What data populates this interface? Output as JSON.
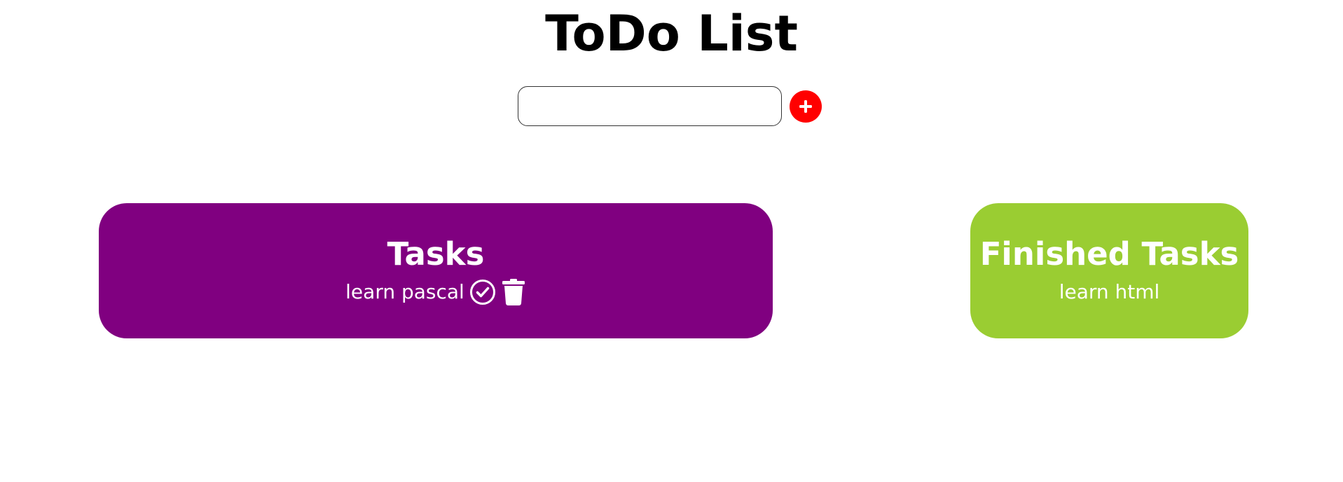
{
  "header": {
    "title": "ToDo List"
  },
  "new_task": {
    "value": "",
    "placeholder": ""
  },
  "colors": {
    "add_button": "#ff0000",
    "tasks_card": "#800080",
    "finished_card": "#9acd32"
  },
  "tasks": {
    "title": "Tasks",
    "items": [
      {
        "label": "learn pascal",
        "icons": [
          "check-circle-icon",
          "trash-icon"
        ]
      }
    ]
  },
  "finished": {
    "title": "Finished Tasks",
    "items": [
      {
        "label": "learn html"
      }
    ]
  }
}
